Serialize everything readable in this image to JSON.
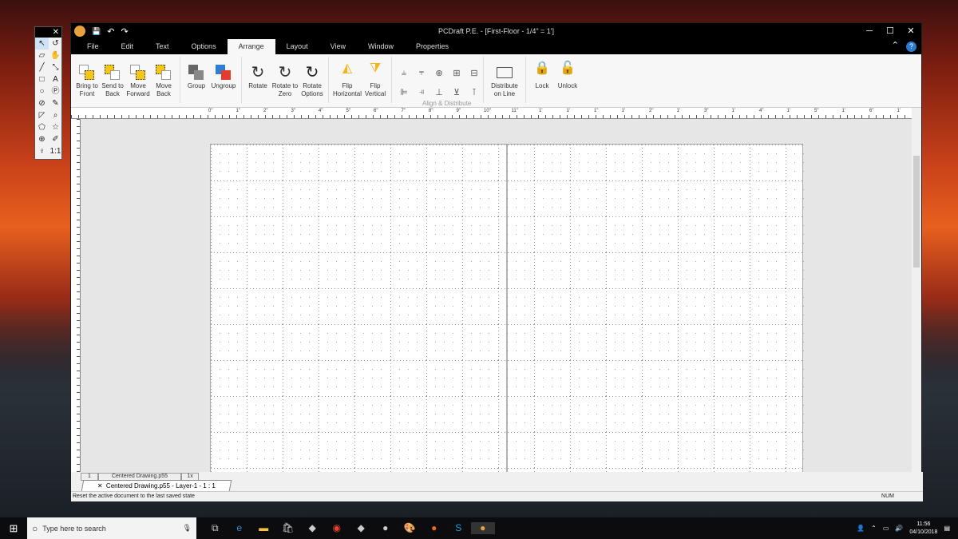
{
  "window": {
    "title": "PCDraft P.E. - [First-Floor - 1/4\" = 1']",
    "minimize": "─",
    "maximize": "☐",
    "close": "✕"
  },
  "quick_access": {
    "save": "💾",
    "undo": "↶",
    "redo": "↷"
  },
  "tabs": [
    "File",
    "Edit",
    "Text",
    "Options",
    "Arrange",
    "Layout",
    "View",
    "Window",
    "Properties"
  ],
  "active_tab": "Arrange",
  "help": "?",
  "ribbon": {
    "order": [
      "Bring to Front",
      "Send to Back",
      "Move Forward",
      "Move Back"
    ],
    "group": [
      "Group",
      "Ungroup"
    ],
    "rotate": [
      "Rotate",
      "Rotate to Zero",
      "Rotate Options"
    ],
    "flip": [
      "Flip Horizontal",
      "Flip Vertical"
    ],
    "align_group_label": "Align & Distribute",
    "distribute": "Distribute on Line",
    "lock": [
      "Lock",
      "Unlock"
    ]
  },
  "ruler_labels": [
    "0\"",
    "1\"",
    "2\"",
    "3\"",
    "4\"",
    "5\"",
    "6\"",
    "7\"",
    "8\"",
    "9\"",
    "10\"",
    "11\"",
    "1'",
    "1'",
    "1\"",
    "1'",
    "2\"",
    "1'",
    "3\"",
    "1'",
    "4\"",
    "1'",
    "5\"",
    "1'",
    "6\"",
    "1'",
    "7\""
  ],
  "layer_bar": {
    "layer_number": "1",
    "drawing_name": "Centered Drawing.p55",
    "zoom": "1x"
  },
  "document_tab": "Centered Drawing.p55 - Layer-1 - 1 : 1",
  "status": {
    "message": "Reset the active document to the last saved state",
    "num": "NUM"
  },
  "toolbox": {
    "close": "✕",
    "tools": [
      "↖",
      "↺",
      "▱",
      "✋",
      "╱",
      "⤡",
      "□",
      "A",
      "○",
      "Ⓟ",
      "⊘",
      "✎",
      "◸",
      "⌕",
      "⬠",
      "☆",
      "⊕",
      "✐",
      "♀",
      "1:1"
    ]
  },
  "taskbar": {
    "search_placeholder": "Type here to search",
    "time": "11:56",
    "date": "04/10/2018"
  }
}
